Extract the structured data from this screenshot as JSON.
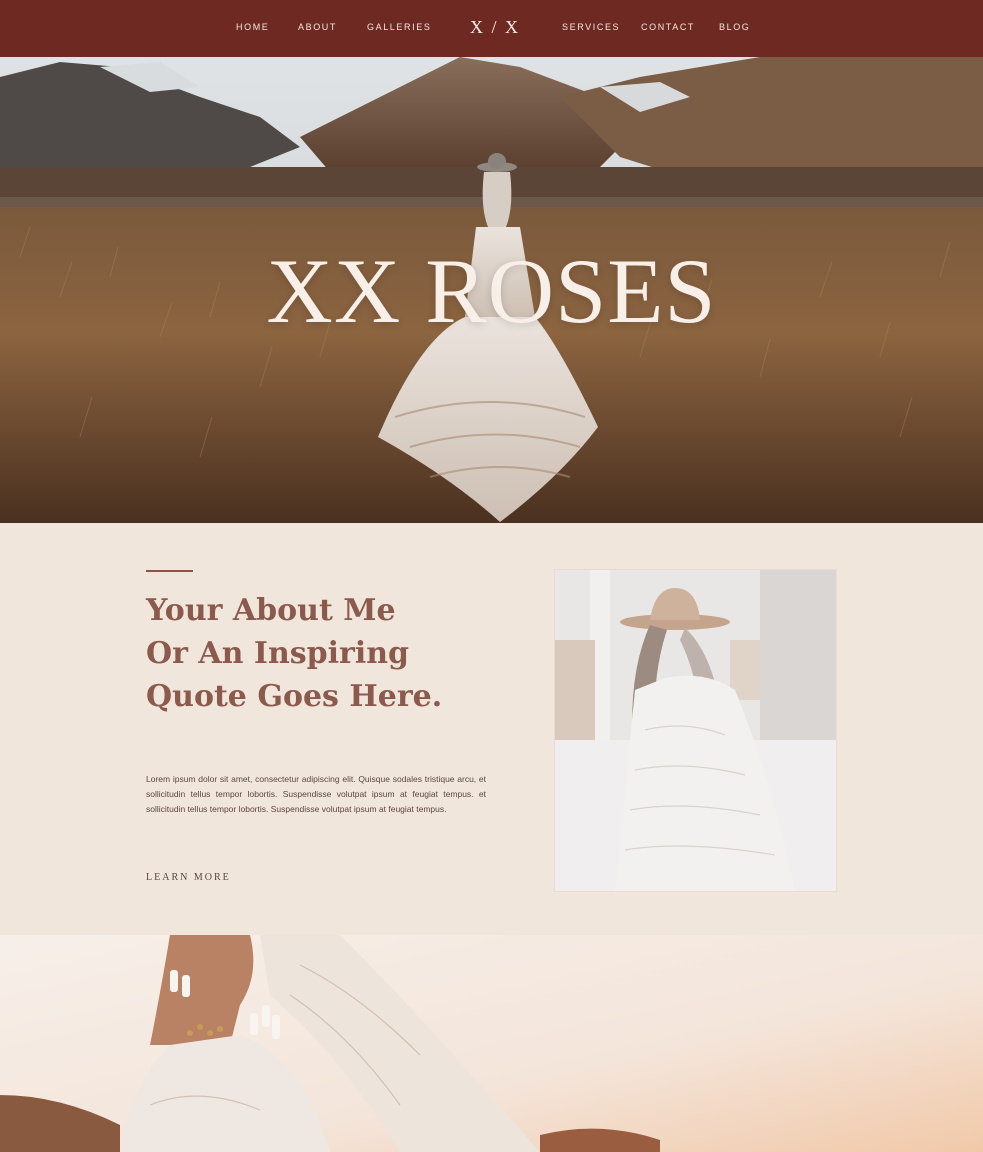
{
  "nav": {
    "items_left": [
      "HOME",
      "ABOUT",
      "GALLERIES"
    ],
    "logo": "X / X",
    "items_right": [
      "SERVICES",
      "CONTACT",
      "BLOG"
    ]
  },
  "hero": {
    "title": "XX ROSES"
  },
  "about": {
    "heading": "Your About Me Or An Inspiring Quote Goes Here.",
    "body": "Lorem ipsum dolor sit amet, consectetur adipiscing elit. Quisque sodales tristique arcu, et sollicitudin tellus tempor lobortis. Suspendisse volutpat ipsum at feugiat tempus.  et sollicitudin tellus tempor lobortis. Suspendisse volutpat ipsum at feugiat tempus.",
    "cta": "LEARN MORE"
  },
  "colors": {
    "nav_bg": "#6e2a22",
    "cream": "#f1e6dc",
    "heading": "#8b5a4c"
  }
}
